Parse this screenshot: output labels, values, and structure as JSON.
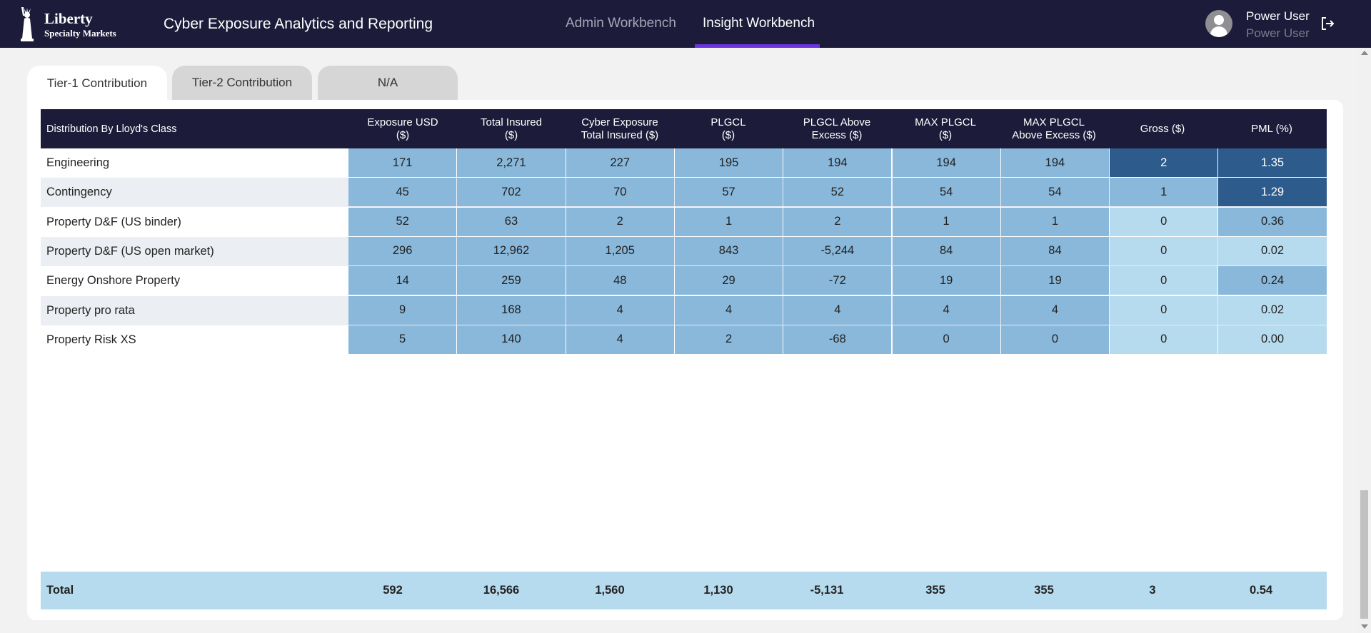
{
  "header": {
    "logo_line1": "Liberty",
    "logo_line2": "Specialty Markets",
    "app_title": "Cyber Exposure Analytics and Reporting",
    "nav": {
      "admin": "Admin Workbench",
      "insight": "Insight Workbench",
      "active": "insight"
    },
    "user": {
      "name": "Power User",
      "role": "Power User"
    },
    "icons": {
      "avatar": "user-avatar-icon",
      "logout": "logout-icon"
    }
  },
  "tabs": [
    {
      "label": "Tier-1 Contribution",
      "active": true
    },
    {
      "label": "Tier-2 Contribution",
      "active": false
    },
    {
      "label": "N/A",
      "active": false
    }
  ],
  "table": {
    "columns": [
      "Distribution By Lloyd's Class",
      "Exposure USD\n($)",
      "Total Insured\n($)",
      "Cyber Exposure\nTotal Insured ($)",
      "PLGCL\n($)",
      "PLGCL Above\nExcess ($)",
      "MAX PLGCL\n($)",
      "MAX PLGCL\nAbove Excess ($)",
      "Gross ($)",
      "PML (%)"
    ],
    "rows": [
      {
        "label": "Engineering",
        "values": [
          "171",
          "2,271",
          "227",
          "195",
          "194",
          "194",
          "194",
          "2",
          "1.35"
        ],
        "shades": [
          "med",
          "med",
          "med",
          "med",
          "med",
          "med",
          "med",
          "dark",
          "dark"
        ]
      },
      {
        "label": "Contingency",
        "values": [
          "45",
          "702",
          "70",
          "57",
          "52",
          "54",
          "54",
          "1",
          "1.29"
        ],
        "shades": [
          "med",
          "med",
          "med",
          "med",
          "med",
          "med",
          "med",
          "med",
          "dark"
        ]
      },
      {
        "label": "Property D&F (US binder)",
        "values": [
          "52",
          "63",
          "2",
          "1",
          "2",
          "1",
          "1",
          "0",
          "0.36"
        ],
        "shades": [
          "med",
          "med",
          "med",
          "med",
          "med",
          "med",
          "med",
          "light",
          "med"
        ]
      },
      {
        "label": "Property D&F (US open market)",
        "values": [
          "296",
          "12,962",
          "1,205",
          "843",
          "-5,244",
          "84",
          "84",
          "0",
          "0.02"
        ],
        "shades": [
          "med",
          "med",
          "med",
          "med",
          "med",
          "med",
          "med",
          "light",
          "light"
        ]
      },
      {
        "label": "Energy Onshore Property",
        "values": [
          "14",
          "259",
          "48",
          "29",
          "-72",
          "19",
          "19",
          "0",
          "0.24"
        ],
        "shades": [
          "med",
          "med",
          "med",
          "med",
          "med",
          "med",
          "med",
          "light",
          "med"
        ]
      },
      {
        "label": "Property pro rata",
        "values": [
          "9",
          "168",
          "4",
          "4",
          "4",
          "4",
          "4",
          "0",
          "0.02"
        ],
        "shades": [
          "med",
          "med",
          "med",
          "med",
          "med",
          "med",
          "med",
          "light",
          "light"
        ]
      },
      {
        "label": "Property Risk XS",
        "values": [
          "5",
          "140",
          "4",
          "2",
          "-68",
          "0",
          "0",
          "0",
          "0.00"
        ],
        "shades": [
          "med",
          "med",
          "med",
          "med",
          "med",
          "med",
          "med",
          "light",
          "light"
        ]
      }
    ],
    "total": {
      "label": "Total",
      "values": [
        "592",
        "16,566",
        "1,560",
        "1,130",
        "-5,131",
        "355",
        "355",
        "3",
        "0.54"
      ]
    }
  },
  "colors": {
    "header_bg": "#1d1b3a",
    "accent": "#6a35e0",
    "cell_med": "#89b8db",
    "cell_light": "#b7dbee",
    "cell_dark": "#2d5b8c"
  }
}
